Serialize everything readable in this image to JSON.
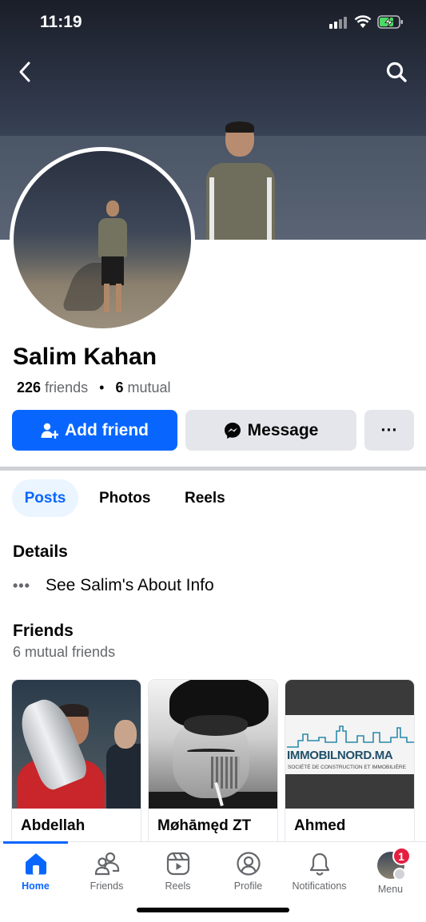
{
  "status_bar": {
    "time": "11:19"
  },
  "profile": {
    "name": "Salim Kahan",
    "friends_count": "226",
    "friends_label": "friends",
    "separator": "•",
    "mutual_count": "6",
    "mutual_label": "mutual"
  },
  "actions": {
    "add_friend": "Add friend",
    "message": "Message",
    "more": "···"
  },
  "tabs": [
    {
      "label": "Posts",
      "active": true
    },
    {
      "label": "Photos",
      "active": false
    },
    {
      "label": "Reels",
      "active": false
    }
  ],
  "details": {
    "heading": "Details",
    "about_link": "See Salim's About Info"
  },
  "friends": {
    "heading": "Friends",
    "subheading": "6 mutual friends",
    "cards": [
      {
        "name": "Abdellah"
      },
      {
        "name": "Møhāmęd ZT"
      },
      {
        "name": "Ahmed",
        "logo_title": "IMMOBILNORD.MA",
        "logo_subtitle": "SOCIÉTÉ DE CONSTRUCTION ET IMMOBILIÈRE"
      }
    ]
  },
  "bottom_nav": [
    {
      "label": "Home",
      "icon": "home-icon",
      "active": true
    },
    {
      "label": "Friends",
      "icon": "friends-icon"
    },
    {
      "label": "Reels",
      "icon": "reels-icon"
    },
    {
      "label": "Profile",
      "icon": "profile-icon"
    },
    {
      "label": "Notifications",
      "icon": "bell-icon"
    },
    {
      "label": "Menu",
      "icon": "menu-avatar",
      "badge": "1"
    }
  ],
  "colors": {
    "primary": "#0866ff",
    "secondary_button": "#e4e6eb",
    "badge": "#e41e3f",
    "muted_text": "#65676b"
  }
}
